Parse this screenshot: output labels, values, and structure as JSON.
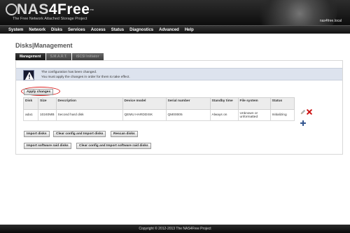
{
  "header": {
    "logo_text": "NAS",
    "logo_accent": "4Free",
    "logo_tm": "™",
    "tagline": "The Free Network Attached Storage Project",
    "hostname": "nas4free.local"
  },
  "menu": [
    "System",
    "Network",
    "Disks",
    "Services",
    "Access",
    "Status",
    "Diagnostics",
    "Advanced",
    "Help"
  ],
  "page": {
    "title": "Disks|Management"
  },
  "tabs": [
    {
      "label": "Management",
      "active": true
    },
    {
      "label": "S.M.A.R.T.",
      "active": false
    },
    {
      "label": "iSCSI Initiator",
      "active": false
    }
  ],
  "notice": {
    "line1": "The configuration has been changed.",
    "line2": "You must apply the changes in order for them to take effect.",
    "icon": "warning-icon"
  },
  "apply_button": "Apply changes",
  "table": {
    "headers": [
      "Disk",
      "Size",
      "Description",
      "Device model",
      "Serial number",
      "Standby time",
      "File system",
      "Status"
    ],
    "rows": [
      [
        "ada1",
        "10240MB",
        "Second hard disk",
        "QEMU HARDDISK",
        "QM00005",
        "Always on",
        "Unknown or unformatted",
        "Initializing"
      ]
    ]
  },
  "buttons": {
    "import_disks": "Import disks",
    "clear_import_disks": "Clear config and Import disks",
    "rescan_disks": "Rescan disks",
    "import_raid": "Import software raid disks",
    "clear_import_raid": "Clear config and Import software raid disks"
  },
  "footer": {
    "text": "Copyright © 2012-2013 The NAS4Free Project"
  },
  "colors": {
    "menubar": "#111111",
    "highlight_circle": "#dd2222",
    "notice_bg": "#dde3ee",
    "delete": "#cc1111",
    "add": "#33558f"
  }
}
